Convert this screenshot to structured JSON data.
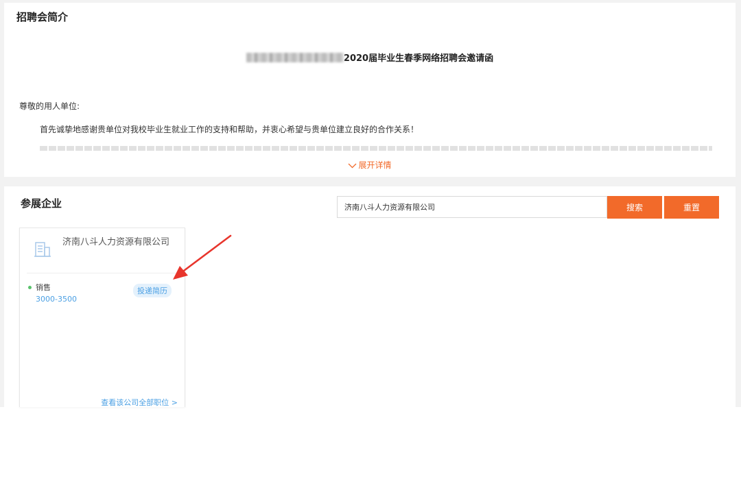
{
  "intro": {
    "title": "招聘会简介",
    "letter_heading": "2020届毕业生春季网络招聘会邀请函",
    "greeting": "尊敬的用人单位:",
    "paragraph1": "首先诚挚地感谢贵单位对我校毕业生就业工作的支持和帮助，并衷心希望与贵单位建立良好的合作关系！",
    "expand_label": "展开详情"
  },
  "exhibitors": {
    "title": "参展企业",
    "search": {
      "value": "济南八斗人力资源有限公司",
      "search_label": "搜索",
      "reset_label": "重置"
    },
    "company": {
      "name": "济南八斗人力资源有限公司",
      "job_title": "销售",
      "salary": "3000-3500",
      "apply_label": "投递简历",
      "view_all_label": "查看该公司全部职位 >"
    }
  },
  "colors": {
    "accent": "#f26a2a",
    "link": "#4a9fe3",
    "annotation": "#e8352c",
    "status_dot": "#58c26b"
  },
  "icons": {
    "company": "building-icon",
    "expand": "chevron-down-icon",
    "annotation": "red-arrow-icon"
  }
}
